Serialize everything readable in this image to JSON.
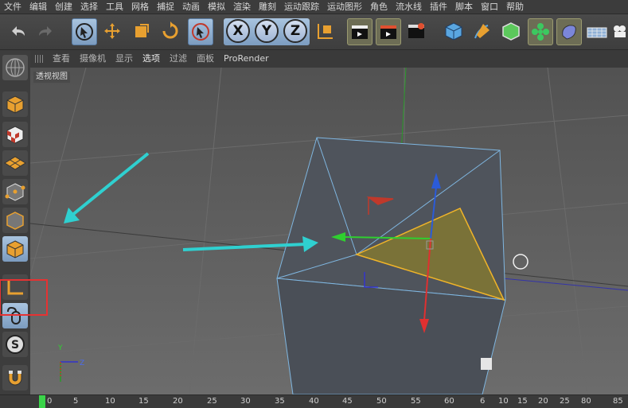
{
  "menu": [
    "文件",
    "编辑",
    "创建",
    "选择",
    "工具",
    "网格",
    "捕捉",
    "动画",
    "模拟",
    "渲染",
    "雕刻",
    "运动跟踪",
    "运动图形",
    "角色",
    "流水线",
    "插件",
    "脚本",
    "窗口",
    "帮助"
  ],
  "axis_buttons": {
    "x": "X",
    "y": "Y",
    "z": "Z"
  },
  "view_menu": [
    "查看",
    "摄像机",
    "显示",
    "选项",
    "过滤",
    "面板",
    "ProRender"
  ],
  "viewport_label": "透视视图",
  "gizmo_axes": {
    "y": "Y",
    "z": "Z"
  },
  "timeline_ticks": [
    "0",
    "5",
    "10",
    "15",
    "20",
    "25",
    "30",
    "35",
    "40",
    "45",
    "50",
    "55",
    "60",
    "6",
    "10",
    "15",
    "20",
    "25",
    "80",
    "85"
  ],
  "colors": {
    "accent_blue": "#7c9cc0",
    "highlight_red": "#e63232",
    "arrow_cyan": "#2fd0d0",
    "polygon_yellow": "#8a7d3a",
    "timeline_marker": "#3bd44a"
  }
}
